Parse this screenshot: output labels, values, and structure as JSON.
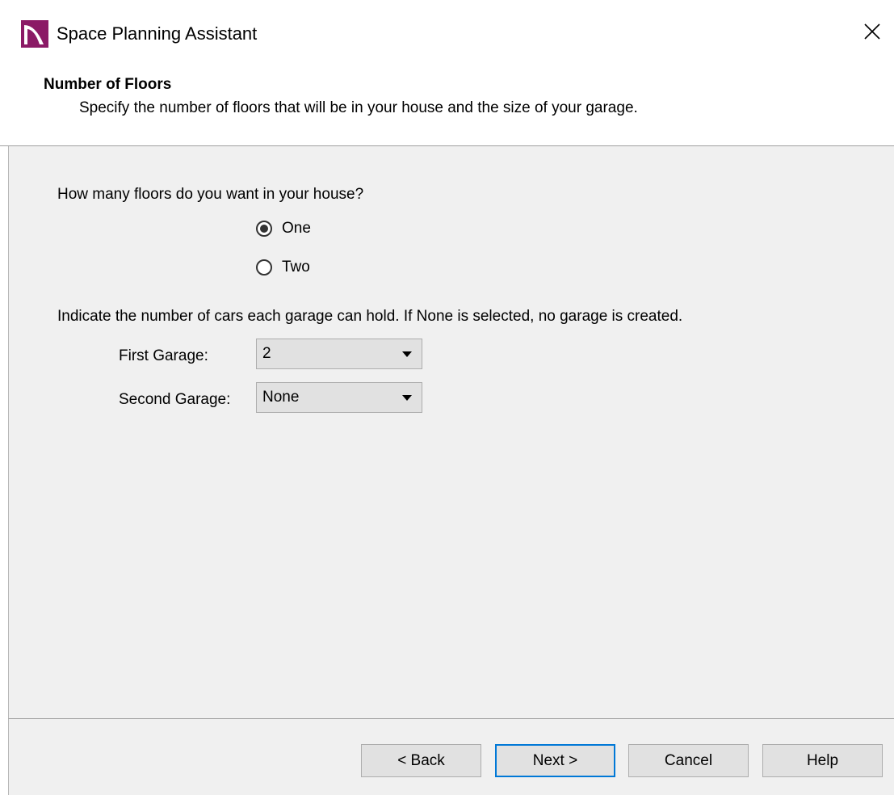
{
  "window": {
    "title": "Space Planning Assistant",
    "icon": "chief-architect-logo-icon",
    "close_icon": "close-icon"
  },
  "header": {
    "title": "Number of Floors",
    "description": "Specify the number of floors that will be in your house and the size of your garage."
  },
  "floors": {
    "question": "How many floors do you want in your house?",
    "options": [
      {
        "label": "One",
        "selected": true
      },
      {
        "label": "Two",
        "selected": false
      }
    ]
  },
  "garage": {
    "instruction": "Indicate the number of cars each garage can hold. If None is selected, no garage is created.",
    "first_label": "First Garage:",
    "first_value": "2",
    "second_label": "Second Garage:",
    "second_value": "None"
  },
  "buttons": {
    "back": "< Back",
    "next": "Next >",
    "cancel": "Cancel",
    "help": "Help"
  },
  "colors": {
    "accent": "#0078d7",
    "logo": "#8b1a66",
    "panel_bg": "#f0f0f0",
    "button_bg": "#e1e1e1"
  }
}
